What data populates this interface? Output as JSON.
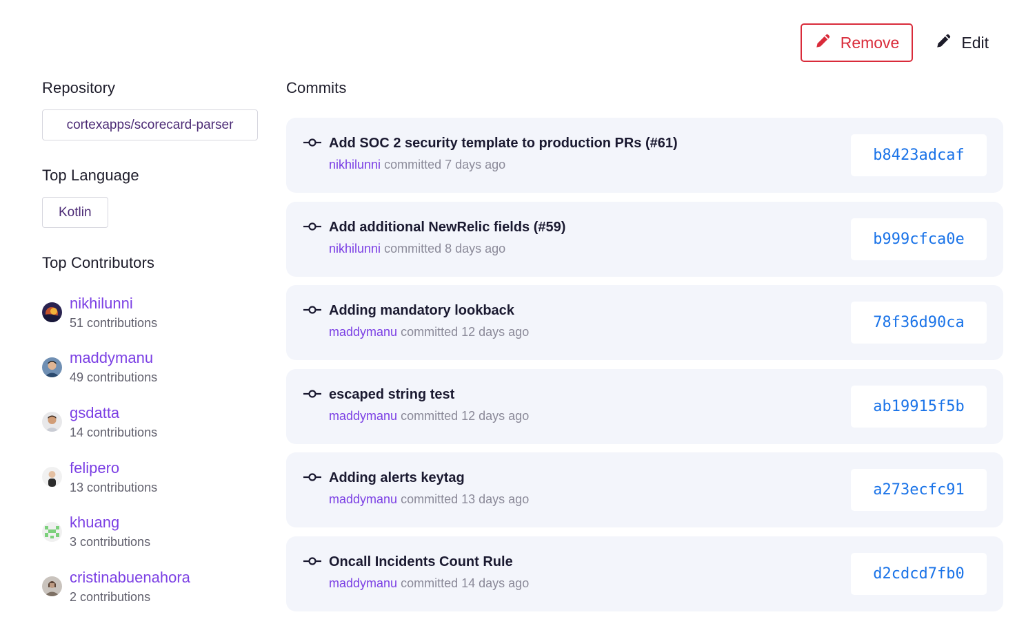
{
  "actions": {
    "remove_label": "Remove",
    "edit_label": "Edit",
    "remove_icon": "pencil-icon",
    "edit_icon": "pencil-icon",
    "remove_color": "#d92b3a"
  },
  "repository": {
    "title": "Repository",
    "name": "cortexapps/scorecard-parser"
  },
  "top_language": {
    "title": "Top Language",
    "value": "Kotlin"
  },
  "top_contributors": {
    "title": "Top Contributors",
    "items": [
      {
        "name": "nikhilunni",
        "contributions": "51 contributions"
      },
      {
        "name": "maddymanu",
        "contributions": "49 contributions"
      },
      {
        "name": "gsdatta",
        "contributions": "14 contributions"
      },
      {
        "name": "felipero",
        "contributions": "13 contributions"
      },
      {
        "name": "khuang",
        "contributions": "3 contributions"
      },
      {
        "name": "cristinabuenahora",
        "contributions": "2 contributions"
      }
    ]
  },
  "commits": {
    "title": "Commits",
    "committed_word": "committed",
    "items": [
      {
        "message": "Add SOC 2 security template to production PRs (#61)",
        "author": "nikhilunni",
        "when": "7 days ago",
        "sha": "b8423adcaf"
      },
      {
        "message": "Add additional NewRelic fields (#59)",
        "author": "nikhilunni",
        "when": "8 days ago",
        "sha": "b999cfca0e"
      },
      {
        "message": "Adding mandatory lookback",
        "author": "maddymanu",
        "when": "12 days ago",
        "sha": "78f36d90ca"
      },
      {
        "message": "escaped string test",
        "author": "maddymanu",
        "when": "12 days ago",
        "sha": "ab19915f5b"
      },
      {
        "message": "Adding alerts keytag",
        "author": "maddymanu",
        "when": "13 days ago",
        "sha": "a273ecfc91"
      },
      {
        "message": "Oncall Incidents Count Rule",
        "author": "maddymanu",
        "when": "14 days ago",
        "sha": "d2cdcd7fb0"
      }
    ]
  },
  "colors": {
    "accent_purple": "#7b3fe4",
    "sha_blue": "#1a73e8",
    "card_bg": "#f3f5fb"
  }
}
